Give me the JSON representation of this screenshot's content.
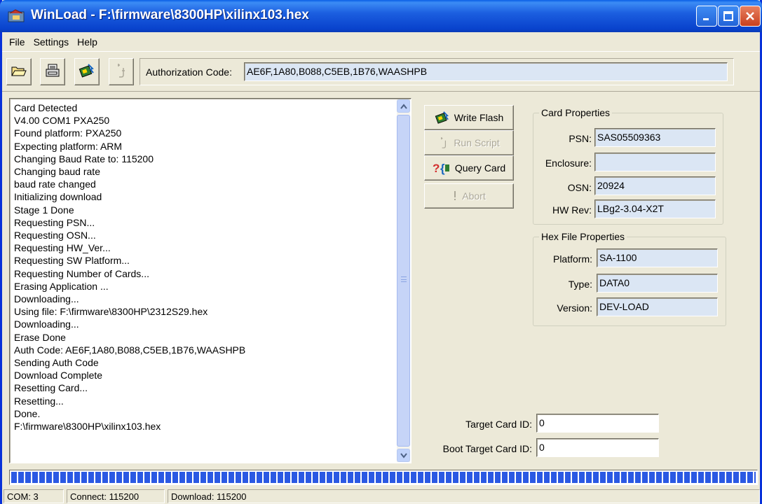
{
  "window": {
    "title": "WinLoad - F:\\firmware\\8300HP\\xilinx103.hex",
    "icons": {
      "app": "winload-app-icon",
      "minimize": "minimize-icon",
      "maximize": "maximize-icon",
      "close": "close-icon"
    }
  },
  "menu": {
    "items": [
      "File",
      "Settings",
      "Help"
    ]
  },
  "toolbar": {
    "icons": [
      "open-folder-icon",
      "save-icon",
      "write-flash-icon",
      "run-script-icon"
    ],
    "auth_label": "Authorization Code:",
    "auth_value": "AE6F,1A80,B088,C5EB,1B76,WAASHPB"
  },
  "log": {
    "lines": [
      "Card Detected",
      "V4.00 COM1 PXA250",
      "Found platform: PXA250",
      "Expecting platform: ARM",
      "Changing Baud Rate to: 115200",
      "Changing baud rate",
      "baud rate changed",
      "Initializing download",
      "Stage 1 Done",
      "Requesting PSN...",
      "Requesting OSN...",
      "Requesting HW_Ver...",
      "Requesting SW Platform...",
      "Requesting Number of Cards...",
      "Erasing Application ...",
      "Downloading...",
      "Using file: F:\\firmware\\8300HP\\2312S29.hex",
      "Downloading...",
      "Erase Done",
      "Auth Code: AE6F,1A80,B088,C5EB,1B76,WAASHPB",
      "Sending Auth Code",
      "Download Complete",
      "Resetting Card...",
      "Resetting...",
      "Done.",
      "F:\\firmware\\8300HP\\xilinx103.hex"
    ]
  },
  "actions": {
    "write_flash": "Write Flash",
    "run_script": "Run Script",
    "query_card": "Query Card",
    "abort": "Abort"
  },
  "card_properties": {
    "title": "Card Properties",
    "psn_label": "PSN:",
    "psn_value": "SAS05509363",
    "enclosure_label": "Enclosure:",
    "enclosure_value": "",
    "osn_label": "OSN:",
    "osn_value": "20924",
    "hwrev_label": "HW Rev:",
    "hwrev_value": "LBg2-3.04-X2T"
  },
  "hex_properties": {
    "title": "Hex File Properties",
    "platform_label": "Platform:",
    "platform_value": "SA-1100",
    "type_label": "Type:",
    "type_value": "DATA0",
    "version_label": "Version:",
    "version_value": "DEV-LOAD"
  },
  "target": {
    "target_label": "Target Card ID:",
    "target_value": "0",
    "boot_label": "Boot Target Card ID:",
    "boot_value": "0"
  },
  "progress": {
    "fraction": 1.0,
    "color": "#2b59e3"
  },
  "status": {
    "com": "COM: 3",
    "connect": "Connect: 115200",
    "download": "Download: 115200"
  }
}
